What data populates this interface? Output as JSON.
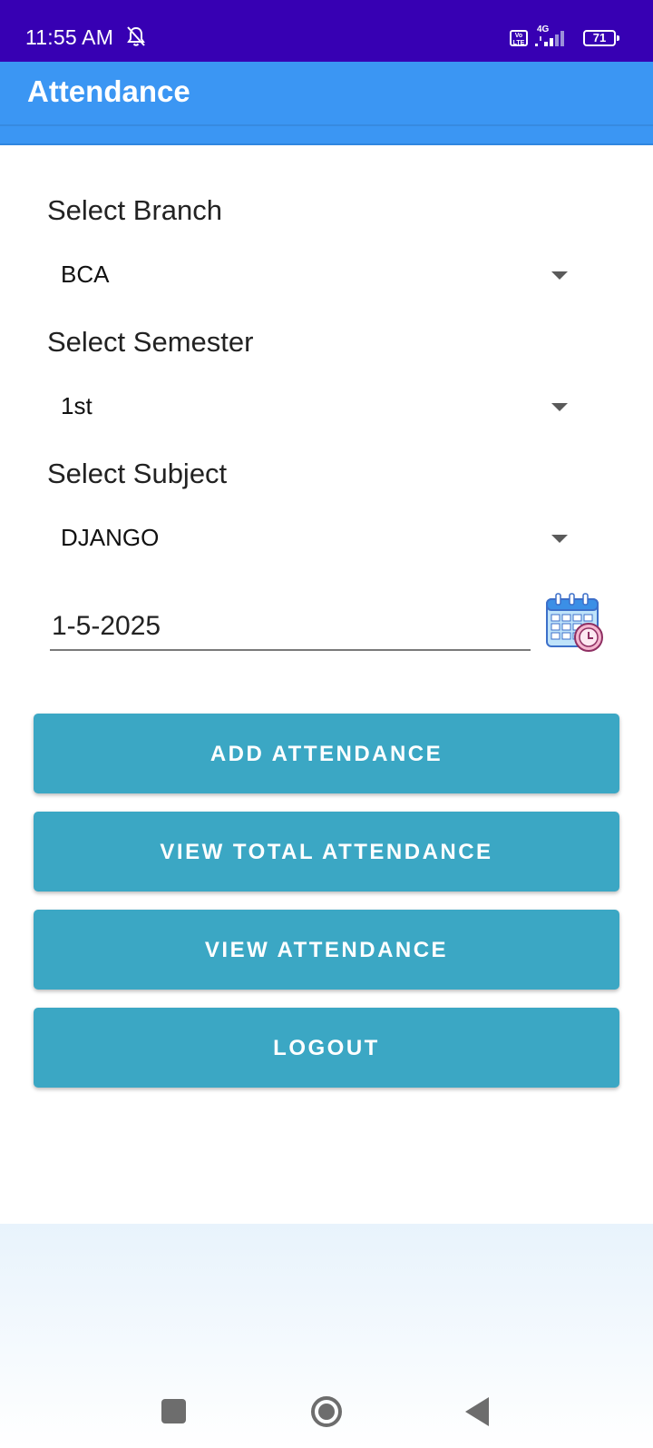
{
  "status_bar": {
    "time": "11:55 AM",
    "network_type": "4G",
    "volte_label": "Vo LTE",
    "battery_level": "71"
  },
  "app_bar": {
    "title": "Attendance"
  },
  "form": {
    "branch": {
      "label": "Select Branch",
      "value": "BCA"
    },
    "semester": {
      "label": "Select Semester",
      "value": "1st"
    },
    "subject": {
      "label": "Select Subject",
      "value": "DJANGO"
    },
    "date": {
      "value": "1-5-2025"
    }
  },
  "buttons": {
    "add_attendance": "ADD ATTENDANCE",
    "view_total_attendance": "VIEW TOTAL ATTENDANCE",
    "view_attendance": "VIEW ATTENDANCE",
    "logout": "LOGOUT"
  },
  "colors": {
    "status_bar": "#3700b3",
    "app_bar": "#3b96f3",
    "button": "#3ba7c4"
  },
  "icons": {
    "bell_off": "bell-off-icon",
    "calendar": "calendar-clock-icon",
    "dropdown": "caret-down-icon",
    "nav_recents": "square-icon",
    "nav_home": "circle-icon",
    "nav_back": "triangle-back-icon"
  }
}
